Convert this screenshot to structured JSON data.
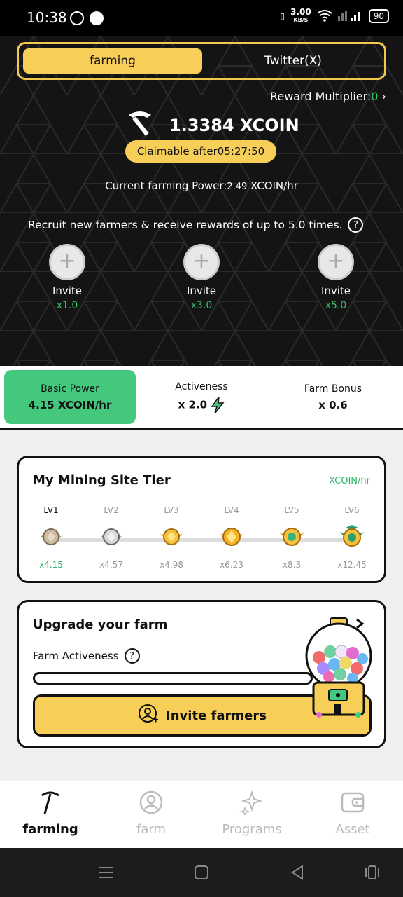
{
  "status_bar": {
    "time": "10:38",
    "net_speed": "3.00",
    "net_unit": "KB/S",
    "battery": "90"
  },
  "tabs": [
    {
      "label": "farming",
      "active": true
    },
    {
      "label": "Twitter(X)",
      "active": false
    }
  ],
  "reward_multiplier": {
    "label": "Reward Multiplier:",
    "value": "0",
    "arrow": "›"
  },
  "balance": {
    "amount": "1.3384",
    "unit": "XCOIN",
    "icon": "pickaxe-icon"
  },
  "claim": "Claimable after05:27:50",
  "power": {
    "label": "Current farming Power:",
    "value": "2.49",
    "unit": " XCOIN/hr"
  },
  "recruit_text": "Recruit new farmers & receive rewards of up to 5.0 times.",
  "invites": [
    {
      "label": "Invite",
      "mult": "x1.0"
    },
    {
      "label": "Invite",
      "mult": "x3.0"
    },
    {
      "label": "Invite",
      "mult": "x5.0"
    }
  ],
  "stats": {
    "basic": {
      "title": "Basic Power",
      "value": "4.15 XCOIN/hr"
    },
    "activeness": {
      "title": "Activeness",
      "value": "x 2.0"
    },
    "bonus": {
      "title": "Farm Bonus",
      "value": "x 0.6"
    }
  },
  "tier": {
    "title": "My Mining Site Tier",
    "unit": "XCOIN/hr",
    "levels": [
      {
        "name": "LV1",
        "mult": "x4.15",
        "current": true
      },
      {
        "name": "LV2",
        "mult": "x4.57"
      },
      {
        "name": "LV3",
        "mult": "x4.98"
      },
      {
        "name": "LV4",
        "mult": "x6.23"
      },
      {
        "name": "LV5",
        "mult": "x8.3"
      },
      {
        "name": "LV6",
        "mult": "x12.45"
      }
    ]
  },
  "upgrade": {
    "title": "Upgrade your farm",
    "activeness_label": "Farm Activeness",
    "button": "Invite farmers"
  },
  "nav": [
    {
      "label": "farming",
      "icon": "pickaxe-icon",
      "active": true
    },
    {
      "label": "farm",
      "icon": "user-icon"
    },
    {
      "label": "Programs",
      "icon": "sparkle-icon"
    },
    {
      "label": "Asset",
      "icon": "wallet-icon"
    }
  ],
  "colors": {
    "accent": "#f7cf58",
    "green": "#43c87d",
    "dark": "#141414"
  }
}
